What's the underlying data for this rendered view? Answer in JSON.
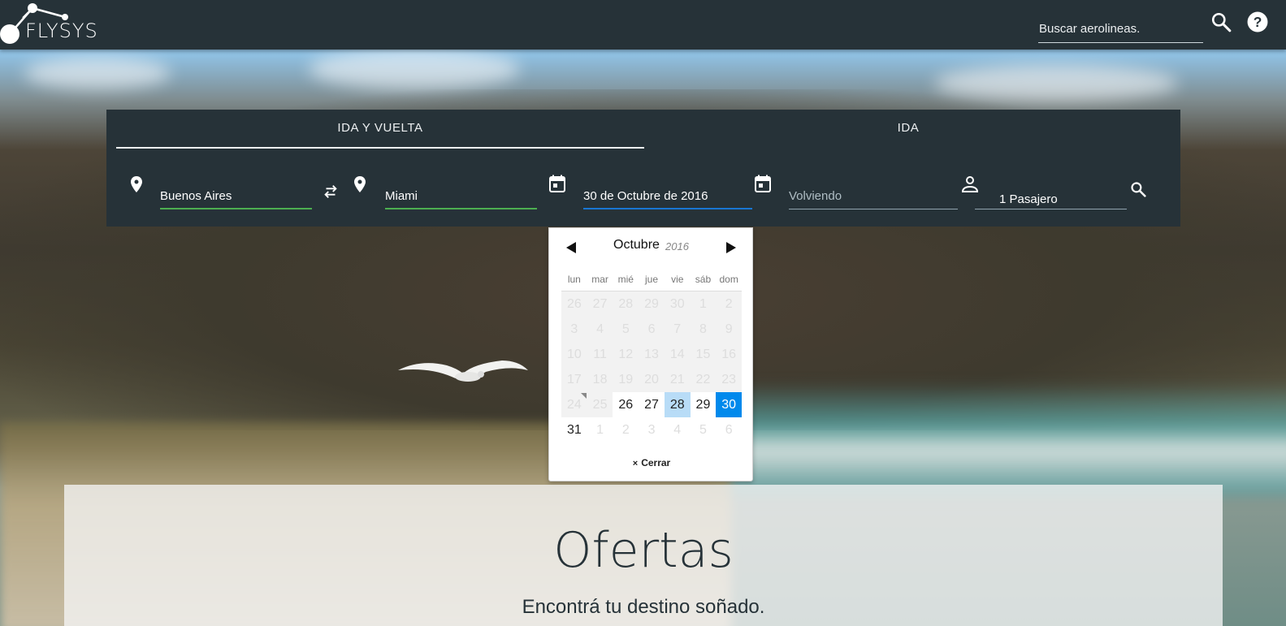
{
  "header": {
    "logo_text": "FLYSYS",
    "search_placeholder": "Buscar aerolineas.",
    "icons": [
      "search-icon",
      "help-icon"
    ]
  },
  "search_panel": {
    "tabs": [
      {
        "label": "IDA Y VUELTA",
        "active": true
      },
      {
        "label": "IDA",
        "active": false
      }
    ],
    "origin": "Buenos Aires",
    "destination": "Miami",
    "departure_date": "30 de Octubre de 2016",
    "return_placeholder": "Volviendo",
    "passengers": "1 Pasajero",
    "colors": {
      "panel": "#263238",
      "valid": "#4caf50",
      "focus": "#1976d2"
    }
  },
  "datepicker": {
    "month": "Octubre",
    "year": "2016",
    "weekdays": [
      "lun",
      "mar",
      "mié",
      "jue",
      "vie",
      "sáb",
      "dom"
    ],
    "weeks": [
      [
        {
          "d": "26",
          "s": "dis"
        },
        {
          "d": "27",
          "s": "dis"
        },
        {
          "d": "28",
          "s": "dis"
        },
        {
          "d": "29",
          "s": "dis"
        },
        {
          "d": "30",
          "s": "dis"
        },
        {
          "d": "1",
          "s": "dis"
        },
        {
          "d": "2",
          "s": "dis"
        }
      ],
      [
        {
          "d": "3",
          "s": "dis"
        },
        {
          "d": "4",
          "s": "dis"
        },
        {
          "d": "5",
          "s": "dis"
        },
        {
          "d": "6",
          "s": "dis"
        },
        {
          "d": "7",
          "s": "dis"
        },
        {
          "d": "8",
          "s": "dis"
        },
        {
          "d": "9",
          "s": "dis"
        }
      ],
      [
        {
          "d": "10",
          "s": "dis"
        },
        {
          "d": "11",
          "s": "dis"
        },
        {
          "d": "12",
          "s": "dis"
        },
        {
          "d": "13",
          "s": "dis"
        },
        {
          "d": "14",
          "s": "dis"
        },
        {
          "d": "15",
          "s": "dis"
        },
        {
          "d": "16",
          "s": "dis"
        }
      ],
      [
        {
          "d": "17",
          "s": "dis"
        },
        {
          "d": "18",
          "s": "dis"
        },
        {
          "d": "19",
          "s": "dis"
        },
        {
          "d": "20",
          "s": "dis"
        },
        {
          "d": "21",
          "s": "dis"
        },
        {
          "d": "22",
          "s": "dis"
        },
        {
          "d": "23",
          "s": "dis"
        }
      ],
      [
        {
          "d": "24",
          "s": "dis mark"
        },
        {
          "d": "25",
          "s": "dis"
        },
        {
          "d": "26",
          "s": ""
        },
        {
          "d": "27",
          "s": ""
        },
        {
          "d": "28",
          "s": "today"
        },
        {
          "d": "29",
          "s": ""
        },
        {
          "d": "30",
          "s": "sel"
        }
      ],
      [
        {
          "d": "31",
          "s": ""
        },
        {
          "d": "1",
          "s": "out"
        },
        {
          "d": "2",
          "s": "out"
        },
        {
          "d": "3",
          "s": "out"
        },
        {
          "d": "4",
          "s": "out"
        },
        {
          "d": "5",
          "s": "out"
        },
        {
          "d": "6",
          "s": "out"
        }
      ]
    ],
    "close_icon": "×",
    "close_label": "Cerrar",
    "colors": {
      "selected": "#0089ec",
      "today": "#b8dcf7"
    }
  },
  "offers": {
    "title": "Ofertas",
    "subtitle": "Encontrá tu destino soñado."
  }
}
